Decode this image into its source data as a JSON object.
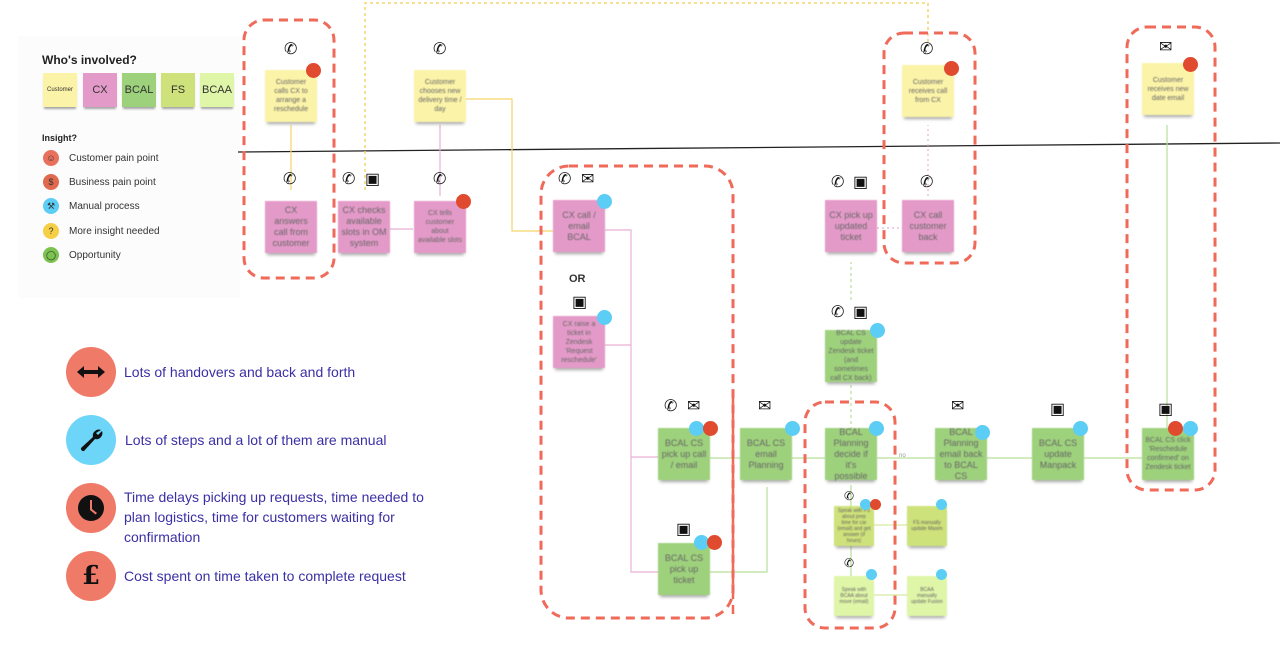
{
  "legend": {
    "whos_involved_title": "Who's involved?",
    "actors": [
      {
        "label": "Customer",
        "color": "#fbf3a8"
      },
      {
        "label": "CX",
        "color": "#e49ac8"
      },
      {
        "label": "BCAL",
        "color": "#9ed17c"
      },
      {
        "label": "FS",
        "color": "#cde27a"
      },
      {
        "label": "BCAA",
        "color": "#dff5a8"
      }
    ],
    "insight_title": "Insight?",
    "insights": [
      {
        "label": "Customer pain point",
        "icon": "person-icon",
        "color": "#e8715e"
      },
      {
        "label": "Business pain point",
        "icon": "dollar-icon",
        "color": "#e8715e"
      },
      {
        "label": "Manual process",
        "icon": "wrench-icon",
        "color": "#5ccdf5"
      },
      {
        "label": "More insight needed",
        "icon": "question-icon",
        "color": "#f5cf45"
      },
      {
        "label": "Opportunity",
        "icon": "lightbulb-icon",
        "color": "#7cc24f"
      }
    ]
  },
  "themes": [
    {
      "text": "Lots of handovers and back and forth",
      "icon": "double-arrow-icon",
      "color": "#f07a68"
    },
    {
      "text": "Lots of steps and a lot of them are manual",
      "icon": "wrench-icon",
      "color": "#6dd5f7"
    },
    {
      "text": "Time delays picking up requests, time needed to plan logistics, time for customers waiting for confirmation",
      "icon": "clock-icon",
      "color": "#f07a68"
    },
    {
      "text": "Cost spent on time taken to complete request",
      "icon": "pound-icon",
      "color": "#f07a68"
    }
  ],
  "flow": {
    "or_label": "OR",
    "no_label": "no",
    "notes": {
      "cust_calls": "Customer calls CX to arrange a reschedule",
      "cust_chooses": "Customer chooses new delivery time / day",
      "cust_receives_call": "Customer receives call from CX",
      "cust_receives_email": "Customer receives new date email",
      "cx_answers": "CX answers call from customer",
      "cx_checks": "CX checks available slots in OM system",
      "cx_tells": "CX tells customer about available slots",
      "cx_call_email": "CX call / email BCAL",
      "cx_raise_ticket": "CX raise a ticket in Zendesk 'Request reschedule'",
      "cx_pickup_ticket": "CX pick up updated ticket",
      "cx_call_back": "CX call customer back",
      "bcal_update_zendesk": "BCAL CS update Zendesk ticket (and sometimes call CX back)",
      "bcal_pickup_call": "BCAL CS pick up call / email",
      "bcal_pickup_ticket": "BCAL CS pick up ticket",
      "bcal_email_planning": "BCAL CS email Planning",
      "bcal_planning_decide": "BCAL Planning decide if it's possible",
      "bcal_planning_email_back": "BCAL Planning email back to BCAL CS",
      "bcal_update_manpack": "BCAL CS update Manpack",
      "bcal_click_confirmed": "BCAL CS click 'Reschedule confirmed' on Zendesk ticket",
      "speak_fs": "Speak with FS about prep time for car (email) and get answer (if hours)",
      "fs_update": "FS manually update Maxim",
      "speak_bcaa": "Speak with BCAA about move (email)",
      "bcaa_update": "BCAA manually update Fusion"
    }
  }
}
